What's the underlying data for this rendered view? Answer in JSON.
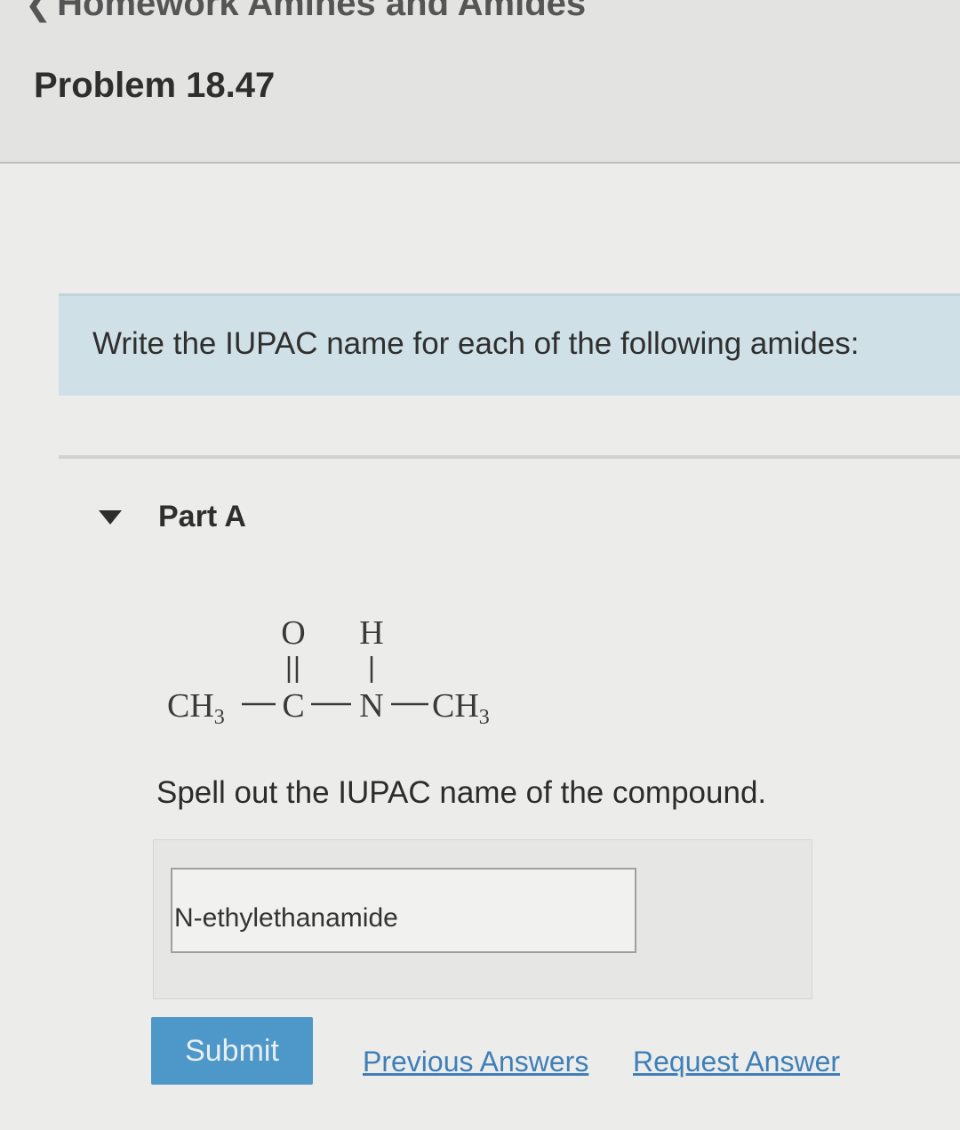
{
  "breadcrumb": {
    "text": "Homework Amines and Amides"
  },
  "problem": {
    "title": "Problem 18.47"
  },
  "instructions": {
    "text": "Write the IUPAC name for each of the following amides:"
  },
  "part": {
    "label": "Part A",
    "expanded": true
  },
  "structure": {
    "top_o": "O",
    "top_h": "H",
    "ch3_left": "CH",
    "c": "C",
    "n": "N",
    "ch3_right": "CH",
    "subscript": "3"
  },
  "question": {
    "prompt": "Spell out the IUPAC name of the compound.",
    "answer_value": "N-ethylethanamide"
  },
  "actions": {
    "submit_label": "Submit",
    "previous_answers_label": "Previous Answers",
    "request_answer_label": "Request Answer"
  },
  "colors": {
    "submit_bg": "#4d97c9",
    "link": "#3f7fb8",
    "instructions_bg": "#cfe0e6"
  }
}
